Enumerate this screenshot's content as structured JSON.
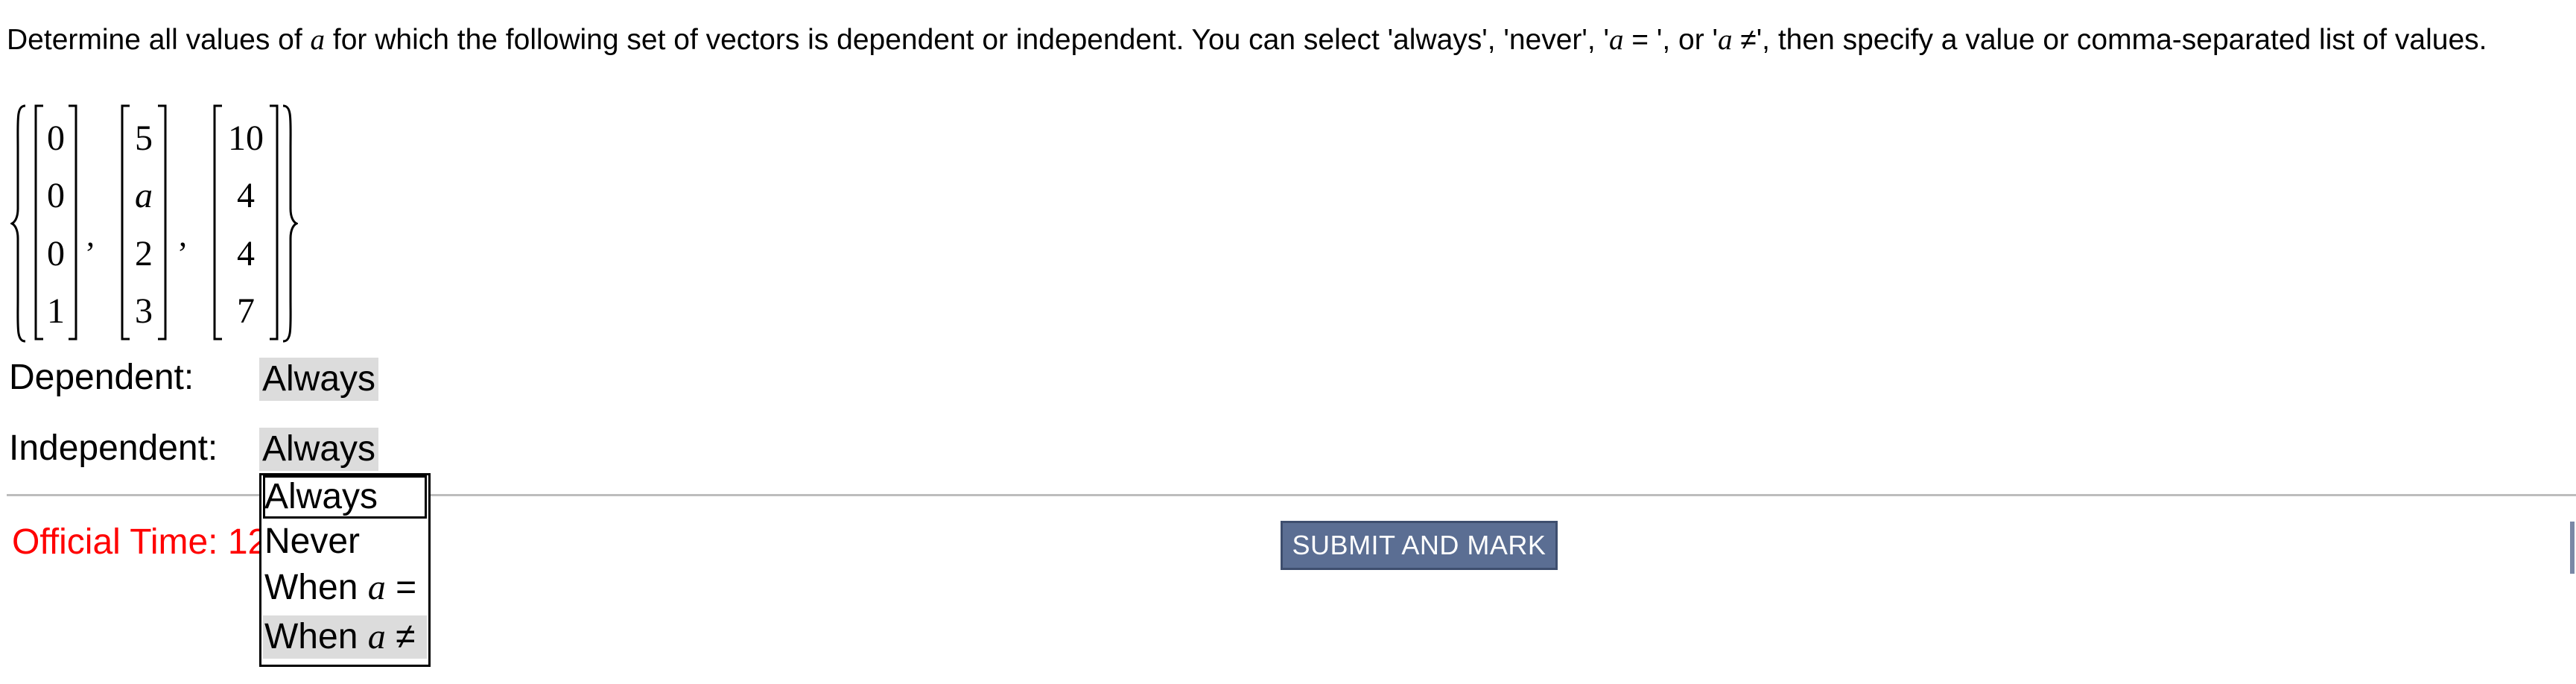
{
  "question": {
    "part1": "Determine all values of ",
    "var": "a",
    "part2": " for which the following set of vectors is dependent or independent. You can select 'always', 'never', '",
    "eq_var": "a",
    "eq_sym": " = ",
    "part3": "', or '",
    "neq_var": "a",
    "neq_sym": " ≠",
    "part4": "', then specify a value or comma-separated list of values."
  },
  "vectors": [
    [
      "0",
      "0",
      "0",
      "1"
    ],
    [
      "5",
      "a",
      "2",
      "3"
    ],
    [
      "10",
      "4",
      "4",
      "7"
    ]
  ],
  "separator": ",",
  "rows": {
    "dependent": {
      "label": "Dependent:",
      "value": "Always"
    },
    "independent": {
      "label": "Independent:",
      "value": "Always"
    }
  },
  "official_time": "Official Time: 12",
  "submit": {
    "label": "SUBMIT AND MARK"
  },
  "dropdown": {
    "options": [
      {
        "text": "Always",
        "var": "",
        "sym": ""
      },
      {
        "text": "Never",
        "var": "",
        "sym": ""
      },
      {
        "text": "When ",
        "var": "a",
        "sym": " ="
      },
      {
        "text": "When ",
        "var": "a",
        "sym": " ≠"
      }
    ],
    "focused_index": 0,
    "hover_index": 3
  },
  "colors": {
    "timer": "#ff0000",
    "button_bg": "#5b6e93",
    "select_bg": "#dcdcdc",
    "rule": "#bdbdbd"
  }
}
